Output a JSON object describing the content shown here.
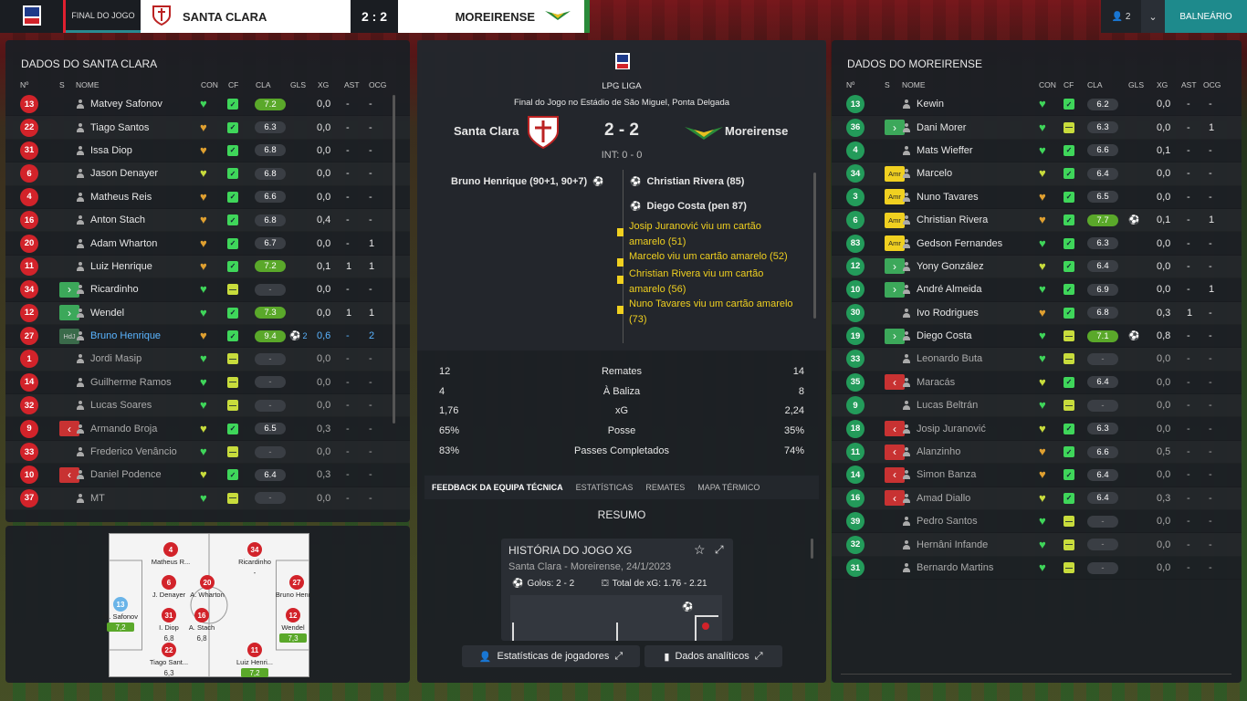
{
  "topbar": {
    "final_label": "FINAL DO JOGO",
    "home_team": "SANTA CLARA",
    "score": "2 : 2",
    "away_team": "MOREIRENSE",
    "users": "2",
    "balneario": "BALNEÁRIO"
  },
  "headers": {
    "num": "Nº",
    "s": "S",
    "name": "NOME",
    "con": "CON",
    "cf": "CF",
    "cla": "CLA",
    "gls": "GLS",
    "xg": "XG",
    "ast": "AST",
    "ocg": "OCG"
  },
  "left": {
    "title": "DADOS DO SANTA CLARA",
    "players": [
      {
        "n": "13",
        "s": "",
        "name": "Matvey Safonov",
        "con": "g",
        "cf": "g",
        "cla": "7.2",
        "clat": "green",
        "gls": "",
        "xg": "0,0",
        "ast": "-",
        "ocg": "-",
        "dim": false
      },
      {
        "n": "22",
        "s": "",
        "name": "Tiago Santos",
        "con": "o",
        "cf": "g",
        "cla": "6.3",
        "clat": "gray",
        "gls": "",
        "xg": "0,0",
        "ast": "-",
        "ocg": "-",
        "dim": false
      },
      {
        "n": "31",
        "s": "",
        "name": "Issa Diop",
        "con": "o",
        "cf": "g",
        "cla": "6.8",
        "clat": "gray",
        "gls": "",
        "xg": "0,0",
        "ast": "-",
        "ocg": "-",
        "dim": false
      },
      {
        "n": "6",
        "s": "",
        "name": "Jason Denayer",
        "con": "y",
        "cf": "g",
        "cla": "6.8",
        "clat": "gray",
        "gls": "",
        "xg": "0,0",
        "ast": "-",
        "ocg": "-",
        "dim": false
      },
      {
        "n": "4",
        "s": "",
        "name": "Matheus Reis",
        "con": "o",
        "cf": "g",
        "cla": "6.6",
        "clat": "gray",
        "gls": "",
        "xg": "0,0",
        "ast": "-",
        "ocg": "-",
        "dim": false
      },
      {
        "n": "16",
        "s": "",
        "name": "Anton Stach",
        "con": "o",
        "cf": "g",
        "cla": "6.8",
        "clat": "gray",
        "gls": "",
        "xg": "0,4",
        "ast": "-",
        "ocg": "-",
        "dim": false
      },
      {
        "n": "20",
        "s": "",
        "name": "Adam Wharton",
        "con": "o",
        "cf": "g",
        "cla": "6.7",
        "clat": "gray",
        "gls": "",
        "xg": "0,0",
        "ast": "-",
        "ocg": "1",
        "dim": false
      },
      {
        "n": "11",
        "s": "",
        "name": "Luiz Henrique",
        "con": "o",
        "cf": "g",
        "cla": "7.2",
        "clat": "green",
        "gls": "",
        "xg": "0,1",
        "ast": "1",
        "ocg": "1",
        "dim": false
      },
      {
        "n": "34",
        "s": "in",
        "name": "Ricardinho",
        "con": "g",
        "cf": "y",
        "cla": "-",
        "clat": "none",
        "gls": "",
        "xg": "0,0",
        "ast": "-",
        "ocg": "-",
        "dim": false
      },
      {
        "n": "12",
        "s": "in",
        "name": "Wendel",
        "con": "g",
        "cf": "g",
        "cla": "7.3",
        "clat": "green",
        "gls": "",
        "xg": "0,0",
        "ast": "1",
        "ocg": "1",
        "dim": false
      },
      {
        "n": "27",
        "s": "hdj",
        "name": "Bruno Henrique",
        "con": "o",
        "cf": "g",
        "cla": "9.4",
        "clat": "green",
        "gls": "2",
        "xg": "0,6",
        "ast": "-",
        "ocg": "2",
        "dim": false,
        "hl": true
      },
      {
        "n": "1",
        "s": "",
        "name": "Jordi Masip",
        "con": "g",
        "cf": "y",
        "cla": "-",
        "clat": "none",
        "gls": "",
        "xg": "0,0",
        "ast": "-",
        "ocg": "-",
        "dim": true
      },
      {
        "n": "14",
        "s": "",
        "name": "Guilherme Ramos",
        "con": "g",
        "cf": "y",
        "cla": "-",
        "clat": "none",
        "gls": "",
        "xg": "0,0",
        "ast": "-",
        "ocg": "-",
        "dim": true
      },
      {
        "n": "32",
        "s": "",
        "name": "Lucas Soares",
        "con": "g",
        "cf": "y",
        "cla": "-",
        "clat": "none",
        "gls": "",
        "xg": "0,0",
        "ast": "-",
        "ocg": "-",
        "dim": true
      },
      {
        "n": "9",
        "s": "out",
        "name": "Armando Broja",
        "con": "y",
        "cf": "g",
        "cla": "6.5",
        "clat": "gray",
        "gls": "",
        "xg": "0,3",
        "ast": "-",
        "ocg": "-",
        "dim": true
      },
      {
        "n": "33",
        "s": "",
        "name": "Frederico Venâncio",
        "con": "g",
        "cf": "y",
        "cla": "-",
        "clat": "none",
        "gls": "",
        "xg": "0,0",
        "ast": "-",
        "ocg": "-",
        "dim": true
      },
      {
        "n": "10",
        "s": "out",
        "name": "Daniel Podence",
        "con": "y",
        "cf": "g",
        "cla": "6.4",
        "clat": "gray",
        "gls": "",
        "xg": "0,3",
        "ast": "-",
        "ocg": "-",
        "dim": true
      },
      {
        "n": "37",
        "s": "",
        "name": "MT",
        "con": "g",
        "cf": "y",
        "cla": "-",
        "clat": "none",
        "gls": "",
        "xg": "0,0",
        "ast": "-",
        "ocg": "-",
        "dim": true
      }
    ]
  },
  "formation": [
    {
      "n": "4",
      "name": "Matheus R...",
      "rate": ""
    },
    {
      "n": "34",
      "name": "Ricardinho",
      "rate": "-"
    },
    {
      "n": "6",
      "name": "J. Denayer",
      "rate": ""
    },
    {
      "n": "20",
      "name": "A. Wharton",
      "rate": ""
    },
    {
      "n": "13",
      "name": "M. Safonov",
      "rate": "7,2"
    },
    {
      "n": "31",
      "name": "I. Diop",
      "rate": "6,8"
    },
    {
      "n": "16",
      "name": "A. Stach",
      "rate": "6,8"
    },
    {
      "n": "27",
      "name": "Bruno Henri...",
      "rate": ""
    },
    {
      "n": "12",
      "name": "Wendel",
      "rate": "7,3"
    },
    {
      "n": "22",
      "name": "Tiago Sant...",
      "rate": "6,3"
    },
    {
      "n": "11",
      "name": "Luiz Henri...",
      "rate": "7,2"
    }
  ],
  "center": {
    "league": "LPG LIGA",
    "venue": "Final do Jogo no Estádio de São Miguel, Ponta Delgada",
    "home": "Santa Clara",
    "away": "Moreirense",
    "score": "2 - 2",
    "ht": "INT: 0 - 0",
    "home_events": [
      "Bruno Henrique (90+1, 90+7)"
    ],
    "away_goals": [
      "Christian Rivera (85)",
      "Diego Costa (pen 87)"
    ],
    "cards": [
      "Josip Juranović viu um cartão amarelo (51)",
      "Marcelo viu um cartão amarelo (52)",
      "Christian Rivera viu um cartão amarelo (56)",
      "Nuno Tavares viu um cartão amarelo (73)"
    ],
    "stats": [
      {
        "h": "12",
        "label": "Remates",
        "a": "14"
      },
      {
        "h": "4",
        "label": "À Baliza",
        "a": "8"
      },
      {
        "h": "1,76",
        "label": "xG",
        "a": "2,24"
      },
      {
        "h": "65%",
        "label": "Posse",
        "a": "35%"
      },
      {
        "h": "83%",
        "label": "Passes Completados",
        "a": "74%"
      }
    ],
    "tabs": [
      "FEEDBACK DA EQUIPA TÉCNICA",
      "ESTATÍSTICAS",
      "REMATES",
      "MAPA TÉRMICO"
    ],
    "resumo": "RESUMO",
    "card_title": "HISTÓRIA DO JOGO XG",
    "card_sub": "Santa Clara - Moreirense, 24/1/2023",
    "golos": "Golos: 2 - 2",
    "total_xg": "Total de xG: 1.76 - 2.21",
    "btn1": "Estatísticas de jogadores",
    "btn2": "Dados analíticos"
  },
  "right": {
    "title": "DADOS DO MOREIRENSE",
    "players": [
      {
        "n": "13",
        "s": "",
        "name": "Kewin",
        "con": "g",
        "cf": "g",
        "cla": "6.2",
        "clat": "gray",
        "gls": "",
        "xg": "0,0",
        "ast": "-",
        "ocg": "-",
        "dim": false
      },
      {
        "n": "36",
        "s": "in",
        "name": "Dani Morer",
        "con": "g",
        "cf": "y",
        "cla": "6.3",
        "clat": "gray",
        "gls": "",
        "xg": "0,0",
        "ast": "-",
        "ocg": "1",
        "dim": false
      },
      {
        "n": "4",
        "s": "",
        "name": "Mats Wieffer",
        "con": "g",
        "cf": "g",
        "cla": "6.6",
        "clat": "gray",
        "gls": "",
        "xg": "0,1",
        "ast": "-",
        "ocg": "-",
        "dim": false
      },
      {
        "n": "34",
        "s": "amr",
        "name": "Marcelo",
        "con": "y",
        "cf": "g",
        "cla": "6.4",
        "clat": "gray",
        "gls": "",
        "xg": "0,0",
        "ast": "-",
        "ocg": "-",
        "dim": false
      },
      {
        "n": "3",
        "s": "amr",
        "name": "Nuno Tavares",
        "con": "o",
        "cf": "g",
        "cla": "6.5",
        "clat": "gray",
        "gls": "",
        "xg": "0,0",
        "ast": "-",
        "ocg": "-",
        "dim": false
      },
      {
        "n": "6",
        "s": "amr",
        "name": "Christian Rivera",
        "con": "o",
        "cf": "g",
        "cla": "7.7",
        "clat": "green",
        "gls": "1",
        "xg": "0,1",
        "ast": "-",
        "ocg": "1",
        "dim": false
      },
      {
        "n": "83",
        "s": "amr",
        "name": "Gedson Fernandes",
        "con": "g",
        "cf": "g",
        "cla": "6.3",
        "clat": "gray",
        "gls": "",
        "xg": "0,0",
        "ast": "-",
        "ocg": "-",
        "dim": false
      },
      {
        "n": "12",
        "s": "in",
        "name": "Yony González",
        "con": "y",
        "cf": "g",
        "cla": "6.4",
        "clat": "gray",
        "gls": "",
        "xg": "0,0",
        "ast": "-",
        "ocg": "-",
        "dim": false
      },
      {
        "n": "10",
        "s": "in",
        "name": "André Almeida",
        "con": "g",
        "cf": "g",
        "cla": "6.9",
        "clat": "gray",
        "gls": "",
        "xg": "0,0",
        "ast": "-",
        "ocg": "1",
        "dim": false
      },
      {
        "n": "30",
        "s": "",
        "name": "Ivo Rodrigues",
        "con": "o",
        "cf": "g",
        "cla": "6.8",
        "clat": "gray",
        "gls": "",
        "xg": "0,3",
        "ast": "1",
        "ocg": "-",
        "dim": false
      },
      {
        "n": "19",
        "s": "in",
        "name": "Diego Costa",
        "con": "g",
        "cf": "y",
        "cla": "7.1",
        "clat": "green",
        "gls": "1",
        "xg": "0,8",
        "ast": "-",
        "ocg": "-",
        "dim": false
      },
      {
        "n": "33",
        "s": "",
        "name": "Leonardo Buta",
        "con": "g",
        "cf": "y",
        "cla": "-",
        "clat": "none",
        "gls": "",
        "xg": "0,0",
        "ast": "-",
        "ocg": "-",
        "dim": true
      },
      {
        "n": "35",
        "s": "out",
        "name": "Maracás",
        "con": "y",
        "cf": "g",
        "cla": "6.4",
        "clat": "gray",
        "gls": "",
        "xg": "0,0",
        "ast": "-",
        "ocg": "-",
        "dim": true
      },
      {
        "n": "9",
        "s": "",
        "name": "Lucas Beltrán",
        "con": "g",
        "cf": "y",
        "cla": "-",
        "clat": "none",
        "gls": "",
        "xg": "0,0",
        "ast": "-",
        "ocg": "-",
        "dim": true
      },
      {
        "n": "18",
        "s": "out",
        "name": "Josip Juranović",
        "con": "y",
        "cf": "g",
        "cla": "6.3",
        "clat": "gray",
        "gls": "",
        "xg": "0,0",
        "ast": "-",
        "ocg": "-",
        "dim": true
      },
      {
        "n": "11",
        "s": "out",
        "name": "Alanzinho",
        "con": "o",
        "cf": "g",
        "cla": "6.6",
        "clat": "gray",
        "gls": "",
        "xg": "0,5",
        "ast": "-",
        "ocg": "-",
        "dim": true
      },
      {
        "n": "14",
        "s": "out",
        "name": "Simon Banza",
        "con": "o",
        "cf": "g",
        "cla": "6.4",
        "clat": "gray",
        "gls": "",
        "xg": "0,0",
        "ast": "-",
        "ocg": "-",
        "dim": true
      },
      {
        "n": "16",
        "s": "out",
        "name": "Amad Diallo",
        "con": "y",
        "cf": "g",
        "cla": "6.4",
        "clat": "gray",
        "gls": "",
        "xg": "0,3",
        "ast": "-",
        "ocg": "-",
        "dim": true
      },
      {
        "n": "39",
        "s": "",
        "name": "Pedro Santos",
        "con": "g",
        "cf": "y",
        "cla": "-",
        "clat": "none",
        "gls": "",
        "xg": "0,0",
        "ast": "-",
        "ocg": "-",
        "dim": true
      },
      {
        "n": "32",
        "s": "",
        "name": "Hernâni Infande",
        "con": "g",
        "cf": "y",
        "cla": "-",
        "clat": "none",
        "gls": "",
        "xg": "0,0",
        "ast": "-",
        "ocg": "-",
        "dim": true
      },
      {
        "n": "31",
        "s": "",
        "name": "Bernardo Martins",
        "con": "g",
        "cf": "y",
        "cla": "-",
        "clat": "none",
        "gls": "",
        "xg": "0,0",
        "ast": "-",
        "ocg": "-",
        "dim": true
      }
    ]
  },
  "colors": {
    "red": "#d2232a",
    "green_num": "#239b5a",
    "accent": "#1e8a8c"
  }
}
